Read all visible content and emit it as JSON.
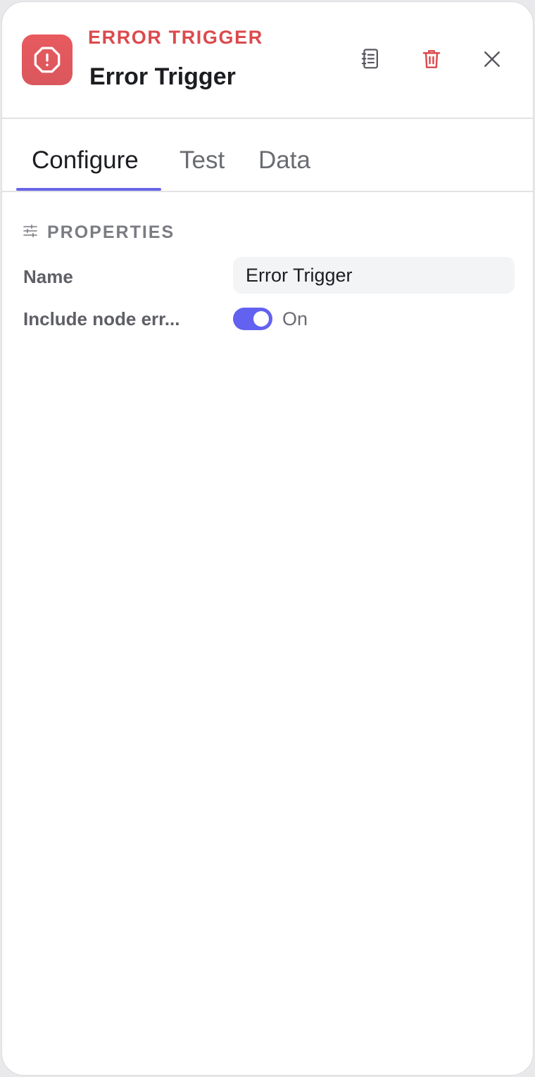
{
  "header": {
    "node_type": "ERROR TRIGGER",
    "node_name": "Error Trigger",
    "icon": "alert-octagon-icon",
    "accent_color": "#dc4a4d",
    "actions": [
      {
        "name": "docs-button",
        "icon": "notebook-icon"
      },
      {
        "name": "delete-button",
        "icon": "trash-icon"
      },
      {
        "name": "close-button",
        "icon": "close-icon"
      }
    ]
  },
  "tabs": [
    {
      "label": "Configure",
      "active": true
    },
    {
      "label": "Test",
      "active": false
    },
    {
      "label": "Data",
      "active": false
    }
  ],
  "properties": {
    "section_title": "PROPERTIES",
    "section_icon": "sliders-icon",
    "name_label": "Name",
    "name_value": "Error Trigger",
    "include_label": "Include node err...",
    "include_state": "On",
    "toggle_color": "#6361f0"
  }
}
